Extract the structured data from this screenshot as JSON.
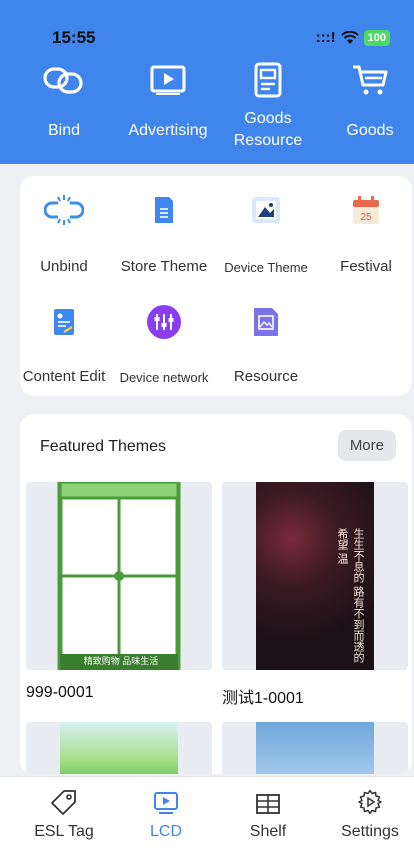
{
  "status": {
    "time": "15:55",
    "signal": ":::!",
    "battery": "100"
  },
  "top_nav": [
    {
      "label": "Bind",
      "icon": "link-icon"
    },
    {
      "label": "Advertising",
      "icon": "play-screen-icon"
    },
    {
      "label": "Goods Resource",
      "icon": "document-icon"
    },
    {
      "label": "Goods",
      "icon": "cart-icon"
    }
  ],
  "tools": [
    {
      "label": "Unbind",
      "icon": "unlink-icon"
    },
    {
      "label": "Store Theme",
      "icon": "store-theme-icon"
    },
    {
      "label": "Device Theme",
      "icon": "device-theme-icon"
    },
    {
      "label": "Festival",
      "icon": "calendar-icon",
      "badge": "25"
    },
    {
      "label": "Content Edit",
      "icon": "content-edit-icon"
    },
    {
      "label": "Device network",
      "icon": "device-network-icon"
    },
    {
      "label": "Resource",
      "icon": "resource-icon"
    }
  ],
  "featured": {
    "title": "Featured Themes",
    "more_label": "More",
    "items": [
      {
        "label": "999-0001",
        "banner_text": "精致购物 品味生活"
      },
      {
        "label": "测试1-0001",
        "poster_text": "生生不息的 路有不到而透的 希望 温"
      },
      {
        "label": ""
      },
      {
        "label": ""
      }
    ]
  },
  "tabs": [
    {
      "label": "ESL Tag",
      "icon": "tag-icon",
      "active": false
    },
    {
      "label": "LCD",
      "icon": "lcd-icon",
      "active": true
    },
    {
      "label": "Shelf",
      "icon": "shelf-icon",
      "active": false
    },
    {
      "label": "Settings",
      "icon": "settings-icon",
      "active": false
    }
  ],
  "colors": {
    "accent": "#3f85ec",
    "header_bg": "#3f85ec",
    "page_bg": "#eef0f4"
  }
}
